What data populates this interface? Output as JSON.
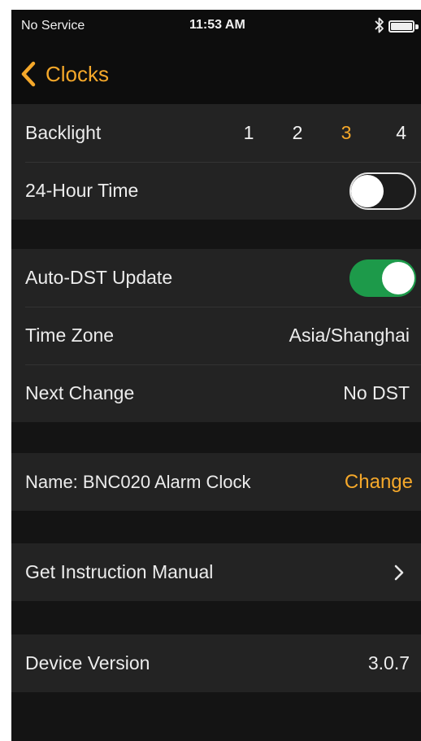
{
  "status_bar": {
    "carrier": "No Service",
    "time": "11:53 AM",
    "icons": [
      "bluetooth-icon",
      "battery-icon"
    ]
  },
  "nav": {
    "back_label": "Clocks",
    "back_icon": "chevron-left-icon"
  },
  "display_group": {
    "backlight_label": "Backlight",
    "backlight_options": [
      "1",
      "2",
      "3",
      "4"
    ],
    "backlight_selected": "3",
    "hour24_label": "24-Hour Time",
    "hour24_enabled": false
  },
  "dst_group": {
    "auto_dst_label": "Auto-DST Update",
    "auto_dst_enabled": true,
    "timezone_label": "Time Zone",
    "timezone_value": "Asia/Shanghai",
    "next_change_label": "Next Change",
    "next_change_value": "No DST"
  },
  "name_group": {
    "name_label": "Name: BNC020 Alarm Clock",
    "change_label": "Change"
  },
  "manual_group": {
    "manual_label": "Get Instruction Manual",
    "manual_icon": "chevron-right-icon"
  },
  "version_group": {
    "version_label": "Device Version",
    "version_value": "3.0.7"
  },
  "colors": {
    "accent": "#f5a82a",
    "toggle_on": "#1d9a4a",
    "background": "#141414",
    "row_background": "#232323"
  }
}
